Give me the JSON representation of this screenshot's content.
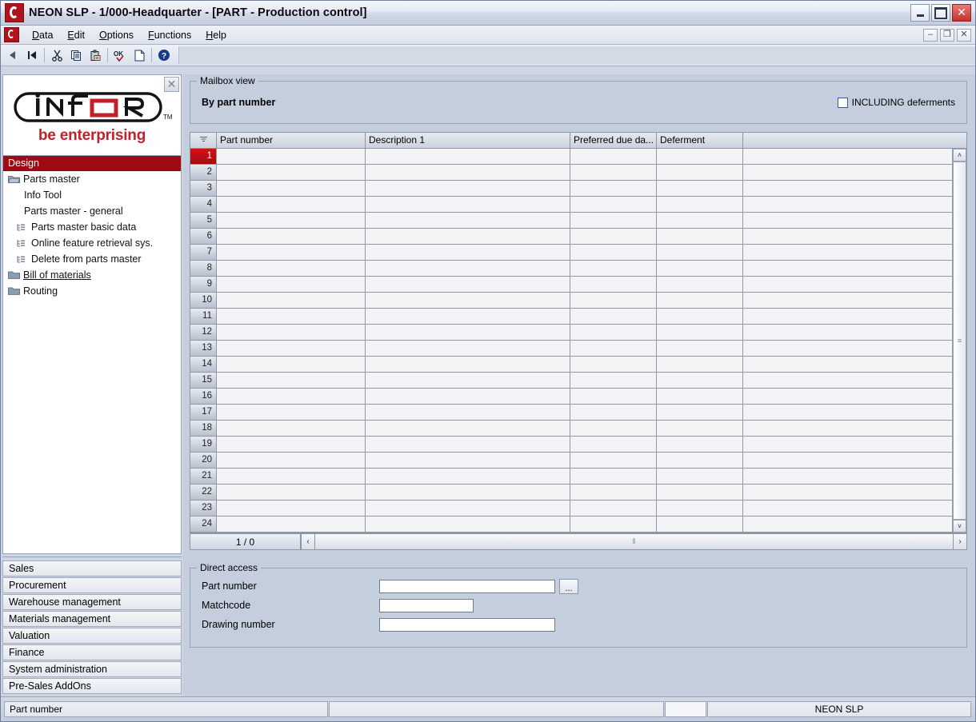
{
  "window": {
    "title": "NEON SLP - 1/000-Headquarter - [PART - Production control]",
    "app_icon": "neon-app-icon",
    "controls": {
      "minimize": "minimize-icon",
      "maximize": "maximize-icon",
      "close": "close-icon"
    }
  },
  "menubar": {
    "items": [
      {
        "label": "Data",
        "accel": "D"
      },
      {
        "label": "Edit",
        "accel": "E"
      },
      {
        "label": "Options",
        "accel": "O"
      },
      {
        "label": "Functions",
        "accel": "F"
      },
      {
        "label": "Help",
        "accel": "H"
      }
    ],
    "mdi_controls": {
      "minimize": "–",
      "restore": "❐",
      "close": "✕"
    }
  },
  "toolbar": {
    "buttons": [
      {
        "name": "back-arrow-icon",
        "glyph": "◀"
      },
      {
        "name": "first-record-icon",
        "glyph": "|◀"
      },
      {
        "name": "cut-icon",
        "glyph": "✂"
      },
      {
        "name": "copy-icon",
        "glyph": "⧉"
      },
      {
        "name": "paste-icon",
        "glyph": "ὌB"
      },
      {
        "name": "ok-confirm-icon",
        "glyph": "OK"
      },
      {
        "name": "new-document-icon",
        "glyph": "□"
      },
      {
        "name": "help-icon",
        "glyph": "?"
      }
    ]
  },
  "sidebar": {
    "close_button": "✕",
    "logo": {
      "wordmark": "infor",
      "trademark": "TM",
      "tagline": "be enterprising",
      "tagline_color": "#c0222a"
    },
    "tree": {
      "header": "Design",
      "header_bg": "#9e0b16",
      "nodes": [
        {
          "label": "Parts master",
          "icon": "folder-open-icon",
          "level": 1,
          "underline": false
        },
        {
          "label": "Info Tool",
          "icon": "none",
          "level": 2,
          "underline": false
        },
        {
          "label": "Parts master - general",
          "icon": "none",
          "level": 2,
          "underline": false
        },
        {
          "label": "Parts master basic data",
          "icon": "tree-leaf-icon",
          "level": 3,
          "underline": false
        },
        {
          "label": "Online feature retrieval sys.",
          "icon": "tree-leaf-icon",
          "level": 3,
          "underline": false
        },
        {
          "label": "Delete from parts master",
          "icon": "tree-leaf-icon",
          "level": 3,
          "underline": false
        },
        {
          "label": "Bill of materials",
          "icon": "folder-icon",
          "level": 1,
          "underline": true
        },
        {
          "label": "Routing",
          "icon": "folder-icon",
          "level": 1,
          "underline": false
        }
      ]
    },
    "modules": [
      {
        "label": "Sales"
      },
      {
        "label": "Procurement"
      },
      {
        "label": "Warehouse management"
      },
      {
        "label": "Materials management"
      },
      {
        "label": "Valuation"
      },
      {
        "label": "Finance"
      },
      {
        "label": "System administration"
      },
      {
        "label": "Pre-Sales AddOns"
      }
    ]
  },
  "mailbox": {
    "group_label": "Mailbox view",
    "title": "By part number",
    "checkbox": {
      "label": "INCLUDING deferments",
      "checked": false
    }
  },
  "grid": {
    "select_header_icon": "column-filter-icon",
    "columns": [
      "Part number",
      "Description 1",
      "Preferred due da...",
      "Deferment",
      ""
    ],
    "rows": [
      {
        "num": "1",
        "selected": true,
        "cells": [
          "",
          "",
          "",
          "",
          ""
        ]
      },
      {
        "num": "2",
        "selected": false,
        "cells": [
          "",
          "",
          "",
          "",
          ""
        ]
      },
      {
        "num": "3",
        "selected": false,
        "cells": [
          "",
          "",
          "",
          "",
          ""
        ]
      },
      {
        "num": "4",
        "selected": false,
        "cells": [
          "",
          "",
          "",
          "",
          ""
        ]
      },
      {
        "num": "5",
        "selected": false,
        "cells": [
          "",
          "",
          "",
          "",
          ""
        ]
      },
      {
        "num": "6",
        "selected": false,
        "cells": [
          "",
          "",
          "",
          "",
          ""
        ]
      },
      {
        "num": "7",
        "selected": false,
        "cells": [
          "",
          "",
          "",
          "",
          ""
        ]
      },
      {
        "num": "8",
        "selected": false,
        "cells": [
          "",
          "",
          "",
          "",
          ""
        ]
      },
      {
        "num": "9",
        "selected": false,
        "cells": [
          "",
          "",
          "",
          "",
          ""
        ]
      },
      {
        "num": "10",
        "selected": false,
        "cells": [
          "",
          "",
          "",
          "",
          ""
        ]
      },
      {
        "num": "11",
        "selected": false,
        "cells": [
          "",
          "",
          "",
          "",
          ""
        ]
      },
      {
        "num": "12",
        "selected": false,
        "cells": [
          "",
          "",
          "",
          "",
          ""
        ]
      },
      {
        "num": "13",
        "selected": false,
        "cells": [
          "",
          "",
          "",
          "",
          ""
        ]
      },
      {
        "num": "14",
        "selected": false,
        "cells": [
          "",
          "",
          "",
          "",
          ""
        ]
      },
      {
        "num": "15",
        "selected": false,
        "cells": [
          "",
          "",
          "",
          "",
          ""
        ]
      },
      {
        "num": "16",
        "selected": false,
        "cells": [
          "",
          "",
          "",
          "",
          ""
        ]
      },
      {
        "num": "17",
        "selected": false,
        "cells": [
          "",
          "",
          "",
          "",
          ""
        ]
      },
      {
        "num": "18",
        "selected": false,
        "cells": [
          "",
          "",
          "",
          "",
          ""
        ]
      },
      {
        "num": "19",
        "selected": false,
        "cells": [
          "",
          "",
          "",
          "",
          ""
        ]
      },
      {
        "num": "20",
        "selected": false,
        "cells": [
          "",
          "",
          "",
          "",
          ""
        ]
      },
      {
        "num": "21",
        "selected": false,
        "cells": [
          "",
          "",
          "",
          "",
          ""
        ]
      },
      {
        "num": "22",
        "selected": false,
        "cells": [
          "",
          "",
          "",
          "",
          ""
        ]
      },
      {
        "num": "23",
        "selected": false,
        "cells": [
          "",
          "",
          "",
          "",
          ""
        ]
      },
      {
        "num": "24",
        "selected": false,
        "cells": [
          "",
          "",
          "",
          "",
          ""
        ]
      }
    ],
    "pagination": "1 / 0",
    "scroll_left_glyph": "‹",
    "scroll_right_glyph": "›",
    "scroll_up_glyph": "˄",
    "scroll_down_glyph": "˅"
  },
  "direct_access": {
    "group_label": "Direct access",
    "fields": [
      {
        "label": "Part number",
        "value": "",
        "placeholder": "",
        "has_browse": true,
        "browse_label": "..."
      },
      {
        "label": "Matchcode",
        "value": "",
        "placeholder": "",
        "has_browse": false,
        "browse_label": ""
      },
      {
        "label": "Drawing number",
        "value": "",
        "placeholder": "",
        "has_browse": false,
        "browse_label": ""
      }
    ]
  },
  "statusbar": {
    "left": "Part number",
    "middle": "",
    "small": "",
    "right": "NEON SLP"
  }
}
